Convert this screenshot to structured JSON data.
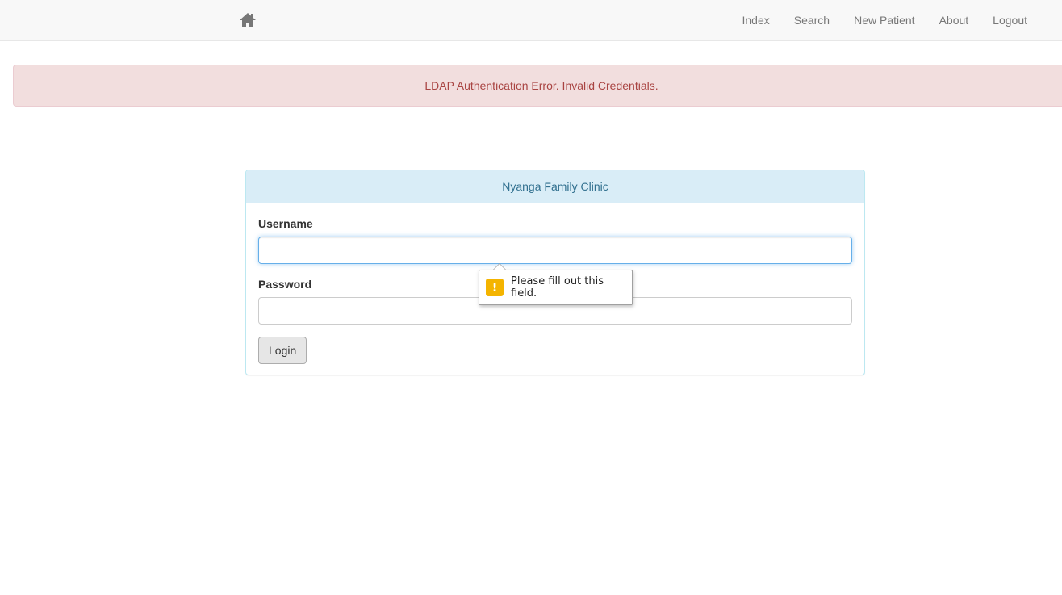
{
  "nav": {
    "home_icon": "home-icon",
    "links": [
      "Index",
      "Search",
      "New Patient",
      "About",
      "Logout"
    ]
  },
  "alert": {
    "message": "LDAP Authentication Error. Invalid Credentials."
  },
  "login_panel": {
    "title": "Nyanga Family Clinic",
    "username_label": "Username",
    "username_value": "",
    "password_label": "Password",
    "password_value": "",
    "login_button": "Login"
  },
  "validation_tooltip": {
    "icon": "warning-icon",
    "message": "Please fill out this field."
  },
  "colors": {
    "navbar_bg": "#f8f8f8",
    "alert_bg": "#f2dede",
    "alert_text": "#a94442",
    "panel_heading_bg": "#d9edf7",
    "panel_heading_text": "#31708f",
    "warning_icon": "#f4b400"
  }
}
